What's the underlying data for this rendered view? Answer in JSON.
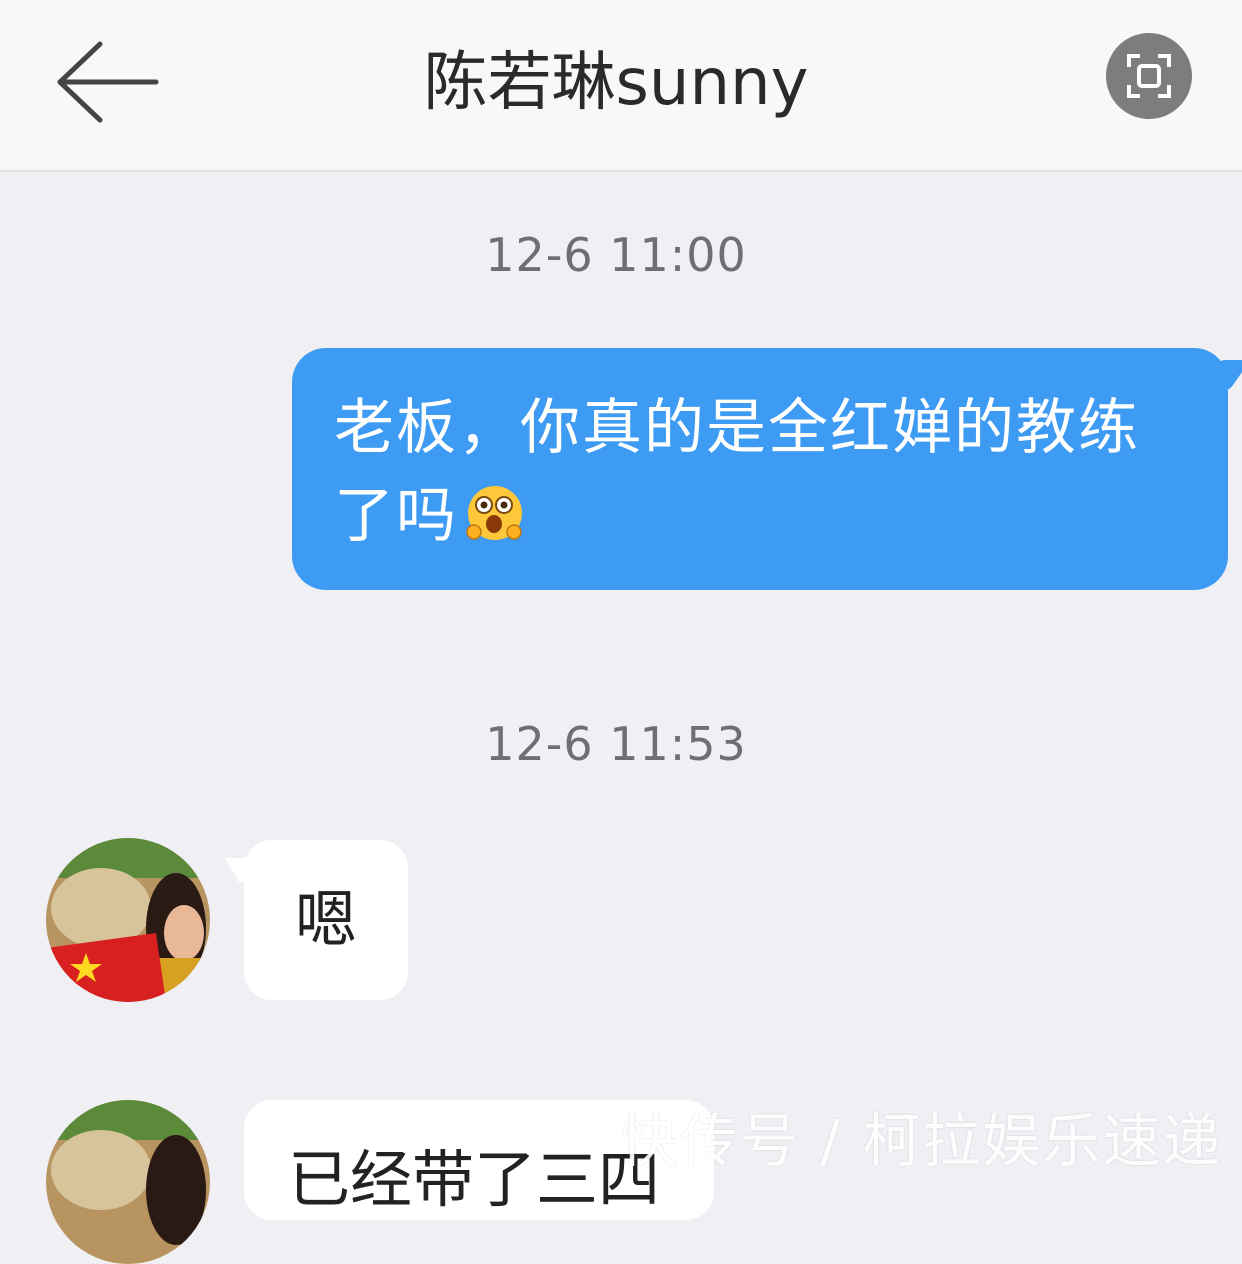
{
  "header": {
    "title": "陈若琳sunny",
    "back_icon": "arrow-left-icon",
    "scan_icon": "screenshot-scan-icon"
  },
  "messages": [
    {
      "type": "timestamp",
      "text": "12-6 11:00"
    },
    {
      "type": "outgoing",
      "text_line1": "老板，你真的是全红婵的教练",
      "text_line2": "了吗",
      "emoji": "hugging-face-emoji"
    },
    {
      "type": "timestamp",
      "text": "12-6 11:53"
    },
    {
      "type": "incoming",
      "text": "嗯"
    },
    {
      "type": "incoming",
      "text": "已经带了三四"
    }
  ],
  "watermark": "快传号 / 柯拉娱乐速递",
  "colors": {
    "outgoing_bubble": "#3d9bf3",
    "incoming_bubble": "#ffffff",
    "background": "#efeff4",
    "header": "#f8f8f8"
  }
}
